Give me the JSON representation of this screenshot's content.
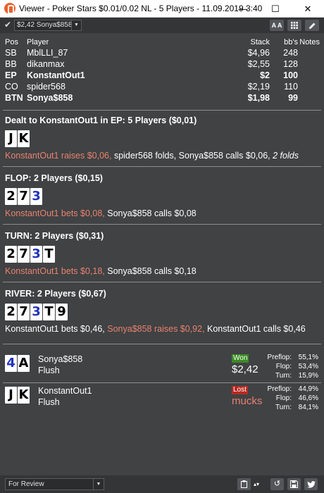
{
  "window": {
    "title": "Viewer - Poker Stars $0.01/0.02 NL - 5 Players - 11.09.2019 3:40",
    "minimize": "—",
    "maximize": "☐",
    "close": "✕"
  },
  "toolbar": {
    "hand_select_value": "$2,42 Sonya$858",
    "font_button": "A A"
  },
  "players_table": {
    "headers": {
      "pos": "Pos",
      "player": "Player",
      "stack": "Stack",
      "bbs": "bb's",
      "notes": "Notes"
    },
    "rows": [
      {
        "pos": "SB",
        "player": "MblLLI_87",
        "stack": "$4,96",
        "bbs": "248"
      },
      {
        "pos": "BB",
        "player": "dikanmax",
        "stack": "$2,55",
        "bbs": "128"
      },
      {
        "pos": "EP",
        "player": "KonstantOut1",
        "stack": "$2",
        "bbs": "100"
      },
      {
        "pos": "CO",
        "player": "spider568",
        "stack": "$2,19",
        "bbs": "110"
      },
      {
        "pos": "BTN",
        "player": "Sonya$858",
        "stack": "$1,98",
        "bbs": "99"
      }
    ]
  },
  "preflop": {
    "title": "Dealt to KonstantOut1 in EP: 5 Players ($0,01)",
    "cards": [
      {
        "rank": "J",
        "color": "black"
      },
      {
        "rank": "K",
        "color": "black"
      }
    ],
    "action_red": "KonstantOut1 raises $0,06,",
    "action_white": " spider568 folds, Sonya$858 calls $0,06, ",
    "action_italic": "2 folds"
  },
  "flop": {
    "title": "FLOP: 2 Players ($0,15)",
    "cards": [
      {
        "rank": "2",
        "color": "black"
      },
      {
        "rank": "7",
        "color": "black"
      },
      {
        "rank": "3",
        "color": "blue"
      }
    ],
    "action_red": "KonstantOut1 bets $0,08,",
    "action_white": " Sonya$858 calls $0,08"
  },
  "turn": {
    "title": "TURN: 2 Players ($0,31)",
    "cards": [
      {
        "rank": "2",
        "color": "black"
      },
      {
        "rank": "7",
        "color": "black"
      },
      {
        "rank": "3",
        "color": "blue"
      },
      {
        "rank": "T",
        "color": "black"
      }
    ],
    "action_red": "KonstantOut1 bets $0,18,",
    "action_white": " Sonya$858 calls $0,18"
  },
  "river": {
    "title": "RIVER: 2 Players ($0,67)",
    "cards": [
      {
        "rank": "2",
        "color": "black"
      },
      {
        "rank": "7",
        "color": "black"
      },
      {
        "rank": "3",
        "color": "blue"
      },
      {
        "rank": "T",
        "color": "black"
      },
      {
        "rank": "9",
        "color": "black"
      }
    ],
    "action_white_1": "KonstantOut1 bets $0,46, ",
    "action_red": "Sonya$858 raises $0,92,",
    "action_white_2": " KonstantOut1 calls $0,46"
  },
  "showdown": [
    {
      "player": "Sonya$858",
      "hand": "Flush",
      "cards": [
        {
          "rank": "4",
          "color": "blue"
        },
        {
          "rank": "A",
          "color": "black"
        }
      ],
      "result": "Won",
      "amount": "$2,42",
      "stats": {
        "preflop": "55,1%",
        "flop": "53,4%",
        "turn": "15,9%"
      }
    },
    {
      "player": "KonstantOut1",
      "hand": "Flush",
      "cards": [
        {
          "rank": "J",
          "color": "black"
        },
        {
          "rank": "K",
          "color": "black"
        }
      ],
      "result": "Lost",
      "amount": "mucks",
      "stats": {
        "preflop": "44,9%",
        "flop": "46,6%",
        "turn": "84,1%"
      }
    }
  ],
  "stat_labels": {
    "preflop": "Preflop:",
    "flop": "Flop:",
    "turn": "Turn:"
  },
  "status_bar": {
    "review_value": "For Review"
  },
  "colors": {
    "background": "#404244",
    "red_action": "#e8826e",
    "blue_card": "#2233bb",
    "won": "#3b8a25",
    "lost": "#b52a22"
  }
}
